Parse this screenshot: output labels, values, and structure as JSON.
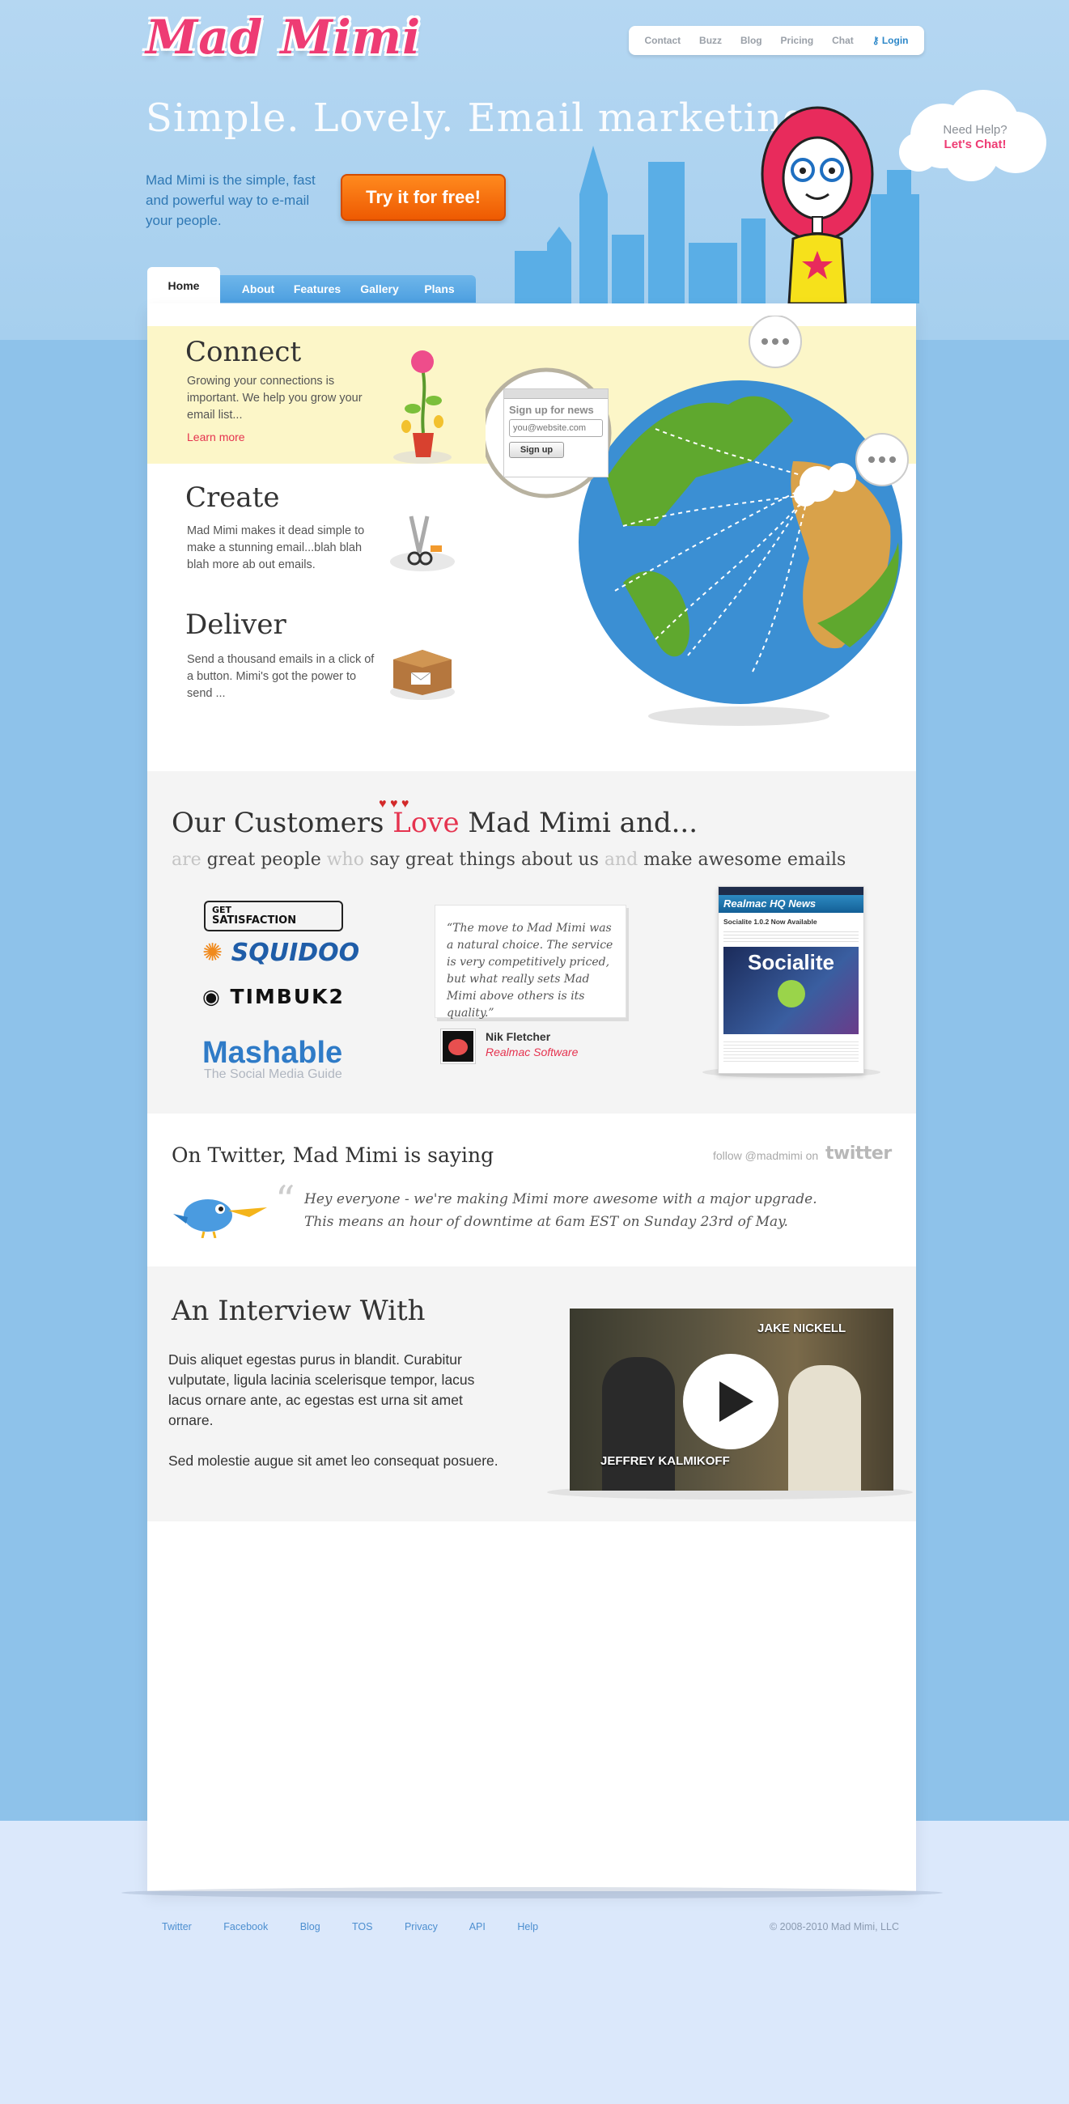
{
  "brand": {
    "logo_text": "Mad Mimi",
    "pink": "#ee3c74",
    "blue": "#2f78b4",
    "orange": "#ee5a02"
  },
  "topnav": {
    "items": [
      "Contact",
      "Buzz",
      "Blog",
      "Pricing",
      "Chat"
    ],
    "login": "Login"
  },
  "hero": {
    "tagline": "Simple. Lovely. Email marketing",
    "intro": "Mad Mimi is the simple, fast and powerful way to e-mail your people.",
    "cta": "Try it for free!"
  },
  "help": {
    "line1": "Need Help?",
    "line2": "Let's Chat!"
  },
  "tabs": {
    "home": "Home",
    "items": [
      "About",
      "Features",
      "Gallery",
      "Plans"
    ]
  },
  "features": [
    {
      "title": "Connect",
      "text": "Growing your connections is important. We help you grow your email list...",
      "link": "Learn more"
    },
    {
      "title": "Create",
      "text": "Mad Mimi makes it dead simple to make a stunning email...blah blah blah more ab out emails."
    },
    {
      "title": "Deliver",
      "text": "Send a thousand emails in a click of a button. Mimi's got the power to send ..."
    }
  ],
  "signup_widget": {
    "title": "Sign up for news",
    "placeholder": "you@website.com",
    "button": "Sign up"
  },
  "customers": {
    "title_a": "Our Customers ",
    "title_love": "Love",
    "title_b": " Mad Mimi and...",
    "sub": {
      "w1": "are ",
      "w2": "great people ",
      "w3": "who ",
      "w4": "say great things about us ",
      "w5": "and ",
      "w6": "make awesome emails"
    },
    "logos": {
      "gs_top": "GET",
      "gs_bottom": "SATISFACTION",
      "squidoo": "SQUIDOO",
      "timbuk2": "TIMBUK2",
      "mashable": "Mashable",
      "mashable_sub": "The Social Media Guide"
    },
    "quote": "“The move to Mad Mimi was a natural choice. The service is very competitively priced, but what really sets Mad Mimi above others is its quality.”",
    "quote_name": "Nik Fletcher",
    "quote_company": "Realmac Software",
    "email_sample": {
      "header": "Realmac HQ News",
      "title": "Socialite 1.0.2 Now Available",
      "promo": "Socialite"
    }
  },
  "twitter": {
    "title": "On Twitter, Mad Mimi is saying",
    "follow": "follow @madmimi on",
    "word": "twitter",
    "quote_mark": "“",
    "text_line1": "Hey everyone - we're making Mimi more awesome with a major upgrade.",
    "text_line2": "This means an hour of downtime at 6am EST on Sunday 23rd of May."
  },
  "interview": {
    "title": "An Interview With",
    "p1": "Duis aliquet egestas purus in blandit. Curabitur vulputate, ligula lacinia scelerisque tempor, lacus lacus ornare ante, ac egestas est urna sit amet ornare.",
    "p2": "Sed molestie augue sit amet leo consequat posuere.",
    "video_label_right": "JAKE NICKELL",
    "video_label_left": "JEFFREY KALMIKOFF"
  },
  "footer": {
    "links": [
      "Twitter",
      "Facebook",
      "Blog",
      "TOS",
      "Privacy",
      "API",
      "Help"
    ],
    "copyright": "© 2008-2010 Mad Mimi, LLC"
  }
}
